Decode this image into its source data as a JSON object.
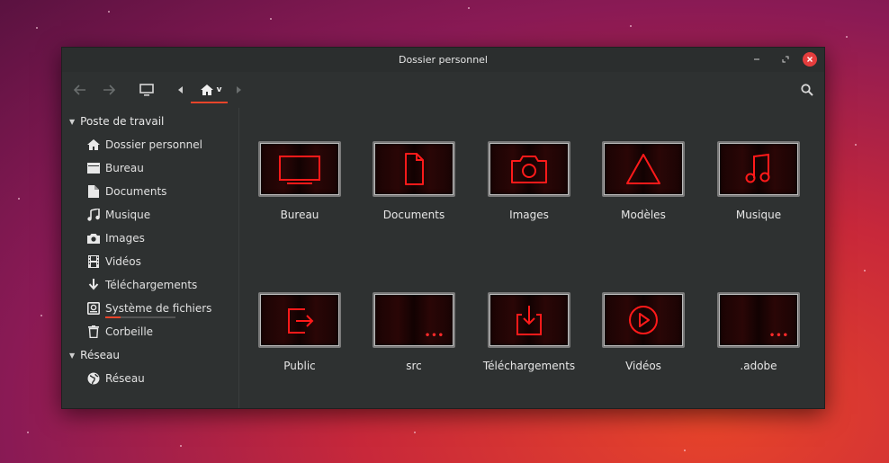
{
  "window": {
    "title": "Dossier personnel"
  },
  "toolbar": {
    "home_caret": "v"
  },
  "sidebar": {
    "sections": [
      {
        "label": "Poste de travail"
      },
      {
        "label": "Réseau"
      }
    ],
    "places": [
      {
        "label": "Dossier personnel",
        "icon": "home-icon"
      },
      {
        "label": "Bureau",
        "icon": "desktop-folder-icon"
      },
      {
        "label": "Documents",
        "icon": "document-icon"
      },
      {
        "label": "Musique",
        "icon": "music-icon"
      },
      {
        "label": "Images",
        "icon": "camera-icon"
      },
      {
        "label": "Vidéos",
        "icon": "film-icon"
      },
      {
        "label": "Téléchargements",
        "icon": "download-icon"
      },
      {
        "label": "Système de fichiers",
        "icon": "drive-icon",
        "usage": 0.22
      },
      {
        "label": "Corbeille",
        "icon": "trash-icon"
      }
    ],
    "network": [
      {
        "label": "Réseau",
        "icon": "globe-icon"
      }
    ]
  },
  "folders": [
    {
      "label": "Bureau",
      "icon": "monitor-icon"
    },
    {
      "label": "Documents",
      "icon": "document-icon"
    },
    {
      "label": "Images",
      "icon": "camera-icon"
    },
    {
      "label": "Modèles",
      "icon": "triangle-icon"
    },
    {
      "label": "Musique",
      "icon": "music-icon"
    },
    {
      "label": "Public",
      "icon": "share-icon"
    },
    {
      "label": "src",
      "icon": "more-icon"
    },
    {
      "label": "Téléchargements",
      "icon": "download-icon"
    },
    {
      "label": "Vidéos",
      "icon": "play-icon"
    },
    {
      "label": ".adobe",
      "icon": "more-icon"
    }
  ],
  "colors": {
    "accent": "#e8452a",
    "folder_glyph": "#ff1a1a",
    "close": "#e53d3d"
  }
}
